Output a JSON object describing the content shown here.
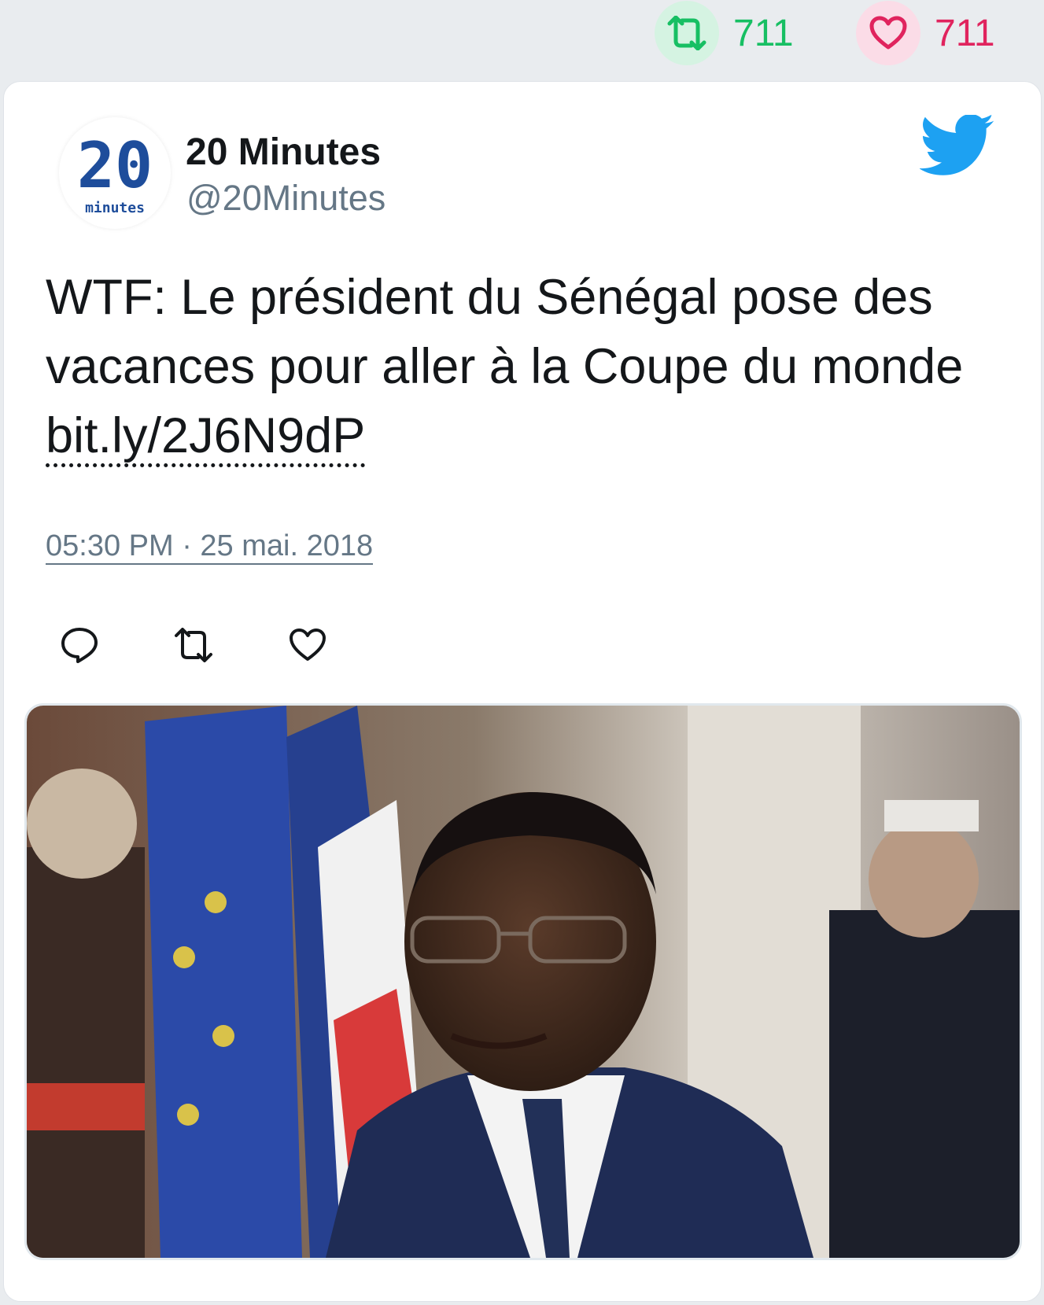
{
  "stats": {
    "retweets": "711",
    "likes": "711",
    "retweet_icon": "retweet-icon",
    "like_icon": "heart-icon",
    "retweet_color": "#17bf63",
    "like_color": "#e0245e"
  },
  "author": {
    "name": "20 Minutes",
    "handle": "@20Minutes",
    "avatar_text": "20",
    "avatar_subtext": "minutes"
  },
  "tweet": {
    "text": "WTF: Le président du Sénégal pose des vacances pour aller à la Coupe du monde ",
    "link": "bit.ly/2J6N9dP",
    "timestamp": "05:30 PM · 25 mai. 2018"
  },
  "actions": [
    {
      "icon": "reply-icon"
    },
    {
      "icon": "retweet-icon"
    },
    {
      "icon": "like-icon"
    }
  ],
  "brand": {
    "twitter_blue": "#1da1f2",
    "avatar_blue": "#1e4d9b"
  },
  "media": {
    "description_icon": "photo"
  }
}
